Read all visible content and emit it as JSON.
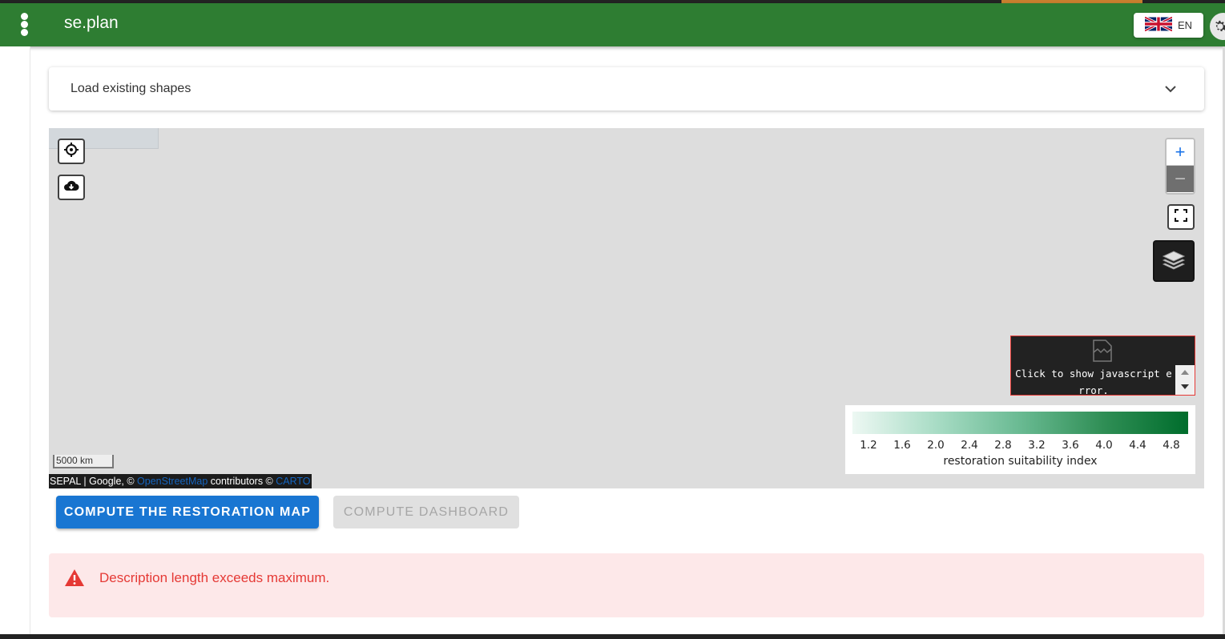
{
  "app": {
    "title": "se.plan"
  },
  "language": {
    "code": "EN"
  },
  "expansion_panel": {
    "label": "Load existing shapes"
  },
  "map": {
    "zoom_in_label": "+",
    "zoom_out_label": "−",
    "error_box": {
      "text": "Click to show javascript error."
    },
    "legend": {
      "ticks": [
        "1.2",
        "1.6",
        "2.0",
        "2.4",
        "2.8",
        "3.2",
        "3.6",
        "4.0",
        "4.4",
        "4.8"
      ],
      "caption": "restoration suitability index",
      "colors": [
        "#edf8f3",
        "#a8dcc5",
        "#69ba92",
        "#2f8e55",
        "#006d2c"
      ]
    },
    "scale": {
      "label": "5000 km"
    },
    "attribution": {
      "prefix": "SEPAL | Google, © ",
      "osm_link": "OpenStreetMap",
      "middle": " contributors © ",
      "carto_link": "CARTO"
    }
  },
  "buttons": {
    "compute_map": "COMPUTE THE RESTORATION MAP",
    "compute_dashboard": "COMPUTE DASHBOARD"
  },
  "alert": {
    "message": "Description length exceeds maximum.",
    "color": "#e53935"
  },
  "theme": {
    "appbar": "#2e7d32",
    "primary": "#1976d2"
  }
}
